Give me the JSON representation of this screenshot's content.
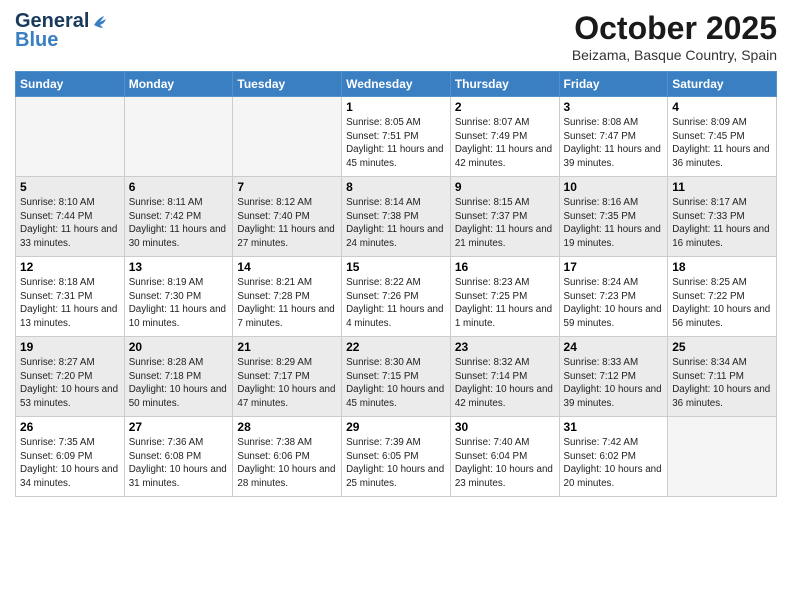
{
  "header": {
    "logo_general": "General",
    "logo_blue": "Blue",
    "month_title": "October 2025",
    "subtitle": "Beizama, Basque Country, Spain"
  },
  "days_of_week": [
    "Sunday",
    "Monday",
    "Tuesday",
    "Wednesday",
    "Thursday",
    "Friday",
    "Saturday"
  ],
  "weeks": [
    [
      {
        "day": "",
        "info": ""
      },
      {
        "day": "",
        "info": ""
      },
      {
        "day": "",
        "info": ""
      },
      {
        "day": "1",
        "info": "Sunrise: 8:05 AM\nSunset: 7:51 PM\nDaylight: 11 hours and 45 minutes."
      },
      {
        "day": "2",
        "info": "Sunrise: 8:07 AM\nSunset: 7:49 PM\nDaylight: 11 hours and 42 minutes."
      },
      {
        "day": "3",
        "info": "Sunrise: 8:08 AM\nSunset: 7:47 PM\nDaylight: 11 hours and 39 minutes."
      },
      {
        "day": "4",
        "info": "Sunrise: 8:09 AM\nSunset: 7:45 PM\nDaylight: 11 hours and 36 minutes."
      }
    ],
    [
      {
        "day": "5",
        "info": "Sunrise: 8:10 AM\nSunset: 7:44 PM\nDaylight: 11 hours and 33 minutes."
      },
      {
        "day": "6",
        "info": "Sunrise: 8:11 AM\nSunset: 7:42 PM\nDaylight: 11 hours and 30 minutes."
      },
      {
        "day": "7",
        "info": "Sunrise: 8:12 AM\nSunset: 7:40 PM\nDaylight: 11 hours and 27 minutes."
      },
      {
        "day": "8",
        "info": "Sunrise: 8:14 AM\nSunset: 7:38 PM\nDaylight: 11 hours and 24 minutes."
      },
      {
        "day": "9",
        "info": "Sunrise: 8:15 AM\nSunset: 7:37 PM\nDaylight: 11 hours and 21 minutes."
      },
      {
        "day": "10",
        "info": "Sunrise: 8:16 AM\nSunset: 7:35 PM\nDaylight: 11 hours and 19 minutes."
      },
      {
        "day": "11",
        "info": "Sunrise: 8:17 AM\nSunset: 7:33 PM\nDaylight: 11 hours and 16 minutes."
      }
    ],
    [
      {
        "day": "12",
        "info": "Sunrise: 8:18 AM\nSunset: 7:31 PM\nDaylight: 11 hours and 13 minutes."
      },
      {
        "day": "13",
        "info": "Sunrise: 8:19 AM\nSunset: 7:30 PM\nDaylight: 11 hours and 10 minutes."
      },
      {
        "day": "14",
        "info": "Sunrise: 8:21 AM\nSunset: 7:28 PM\nDaylight: 11 hours and 7 minutes."
      },
      {
        "day": "15",
        "info": "Sunrise: 8:22 AM\nSunset: 7:26 PM\nDaylight: 11 hours and 4 minutes."
      },
      {
        "day": "16",
        "info": "Sunrise: 8:23 AM\nSunset: 7:25 PM\nDaylight: 11 hours and 1 minute."
      },
      {
        "day": "17",
        "info": "Sunrise: 8:24 AM\nSunset: 7:23 PM\nDaylight: 10 hours and 59 minutes."
      },
      {
        "day": "18",
        "info": "Sunrise: 8:25 AM\nSunset: 7:22 PM\nDaylight: 10 hours and 56 minutes."
      }
    ],
    [
      {
        "day": "19",
        "info": "Sunrise: 8:27 AM\nSunset: 7:20 PM\nDaylight: 10 hours and 53 minutes."
      },
      {
        "day": "20",
        "info": "Sunrise: 8:28 AM\nSunset: 7:18 PM\nDaylight: 10 hours and 50 minutes."
      },
      {
        "day": "21",
        "info": "Sunrise: 8:29 AM\nSunset: 7:17 PM\nDaylight: 10 hours and 47 minutes."
      },
      {
        "day": "22",
        "info": "Sunrise: 8:30 AM\nSunset: 7:15 PM\nDaylight: 10 hours and 45 minutes."
      },
      {
        "day": "23",
        "info": "Sunrise: 8:32 AM\nSunset: 7:14 PM\nDaylight: 10 hours and 42 minutes."
      },
      {
        "day": "24",
        "info": "Sunrise: 8:33 AM\nSunset: 7:12 PM\nDaylight: 10 hours and 39 minutes."
      },
      {
        "day": "25",
        "info": "Sunrise: 8:34 AM\nSunset: 7:11 PM\nDaylight: 10 hours and 36 minutes."
      }
    ],
    [
      {
        "day": "26",
        "info": "Sunrise: 7:35 AM\nSunset: 6:09 PM\nDaylight: 10 hours and 34 minutes."
      },
      {
        "day": "27",
        "info": "Sunrise: 7:36 AM\nSunset: 6:08 PM\nDaylight: 10 hours and 31 minutes."
      },
      {
        "day": "28",
        "info": "Sunrise: 7:38 AM\nSunset: 6:06 PM\nDaylight: 10 hours and 28 minutes."
      },
      {
        "day": "29",
        "info": "Sunrise: 7:39 AM\nSunset: 6:05 PM\nDaylight: 10 hours and 25 minutes."
      },
      {
        "day": "30",
        "info": "Sunrise: 7:40 AM\nSunset: 6:04 PM\nDaylight: 10 hours and 23 minutes."
      },
      {
        "day": "31",
        "info": "Sunrise: 7:42 AM\nSunset: 6:02 PM\nDaylight: 10 hours and 20 minutes."
      },
      {
        "day": "",
        "info": ""
      }
    ]
  ]
}
